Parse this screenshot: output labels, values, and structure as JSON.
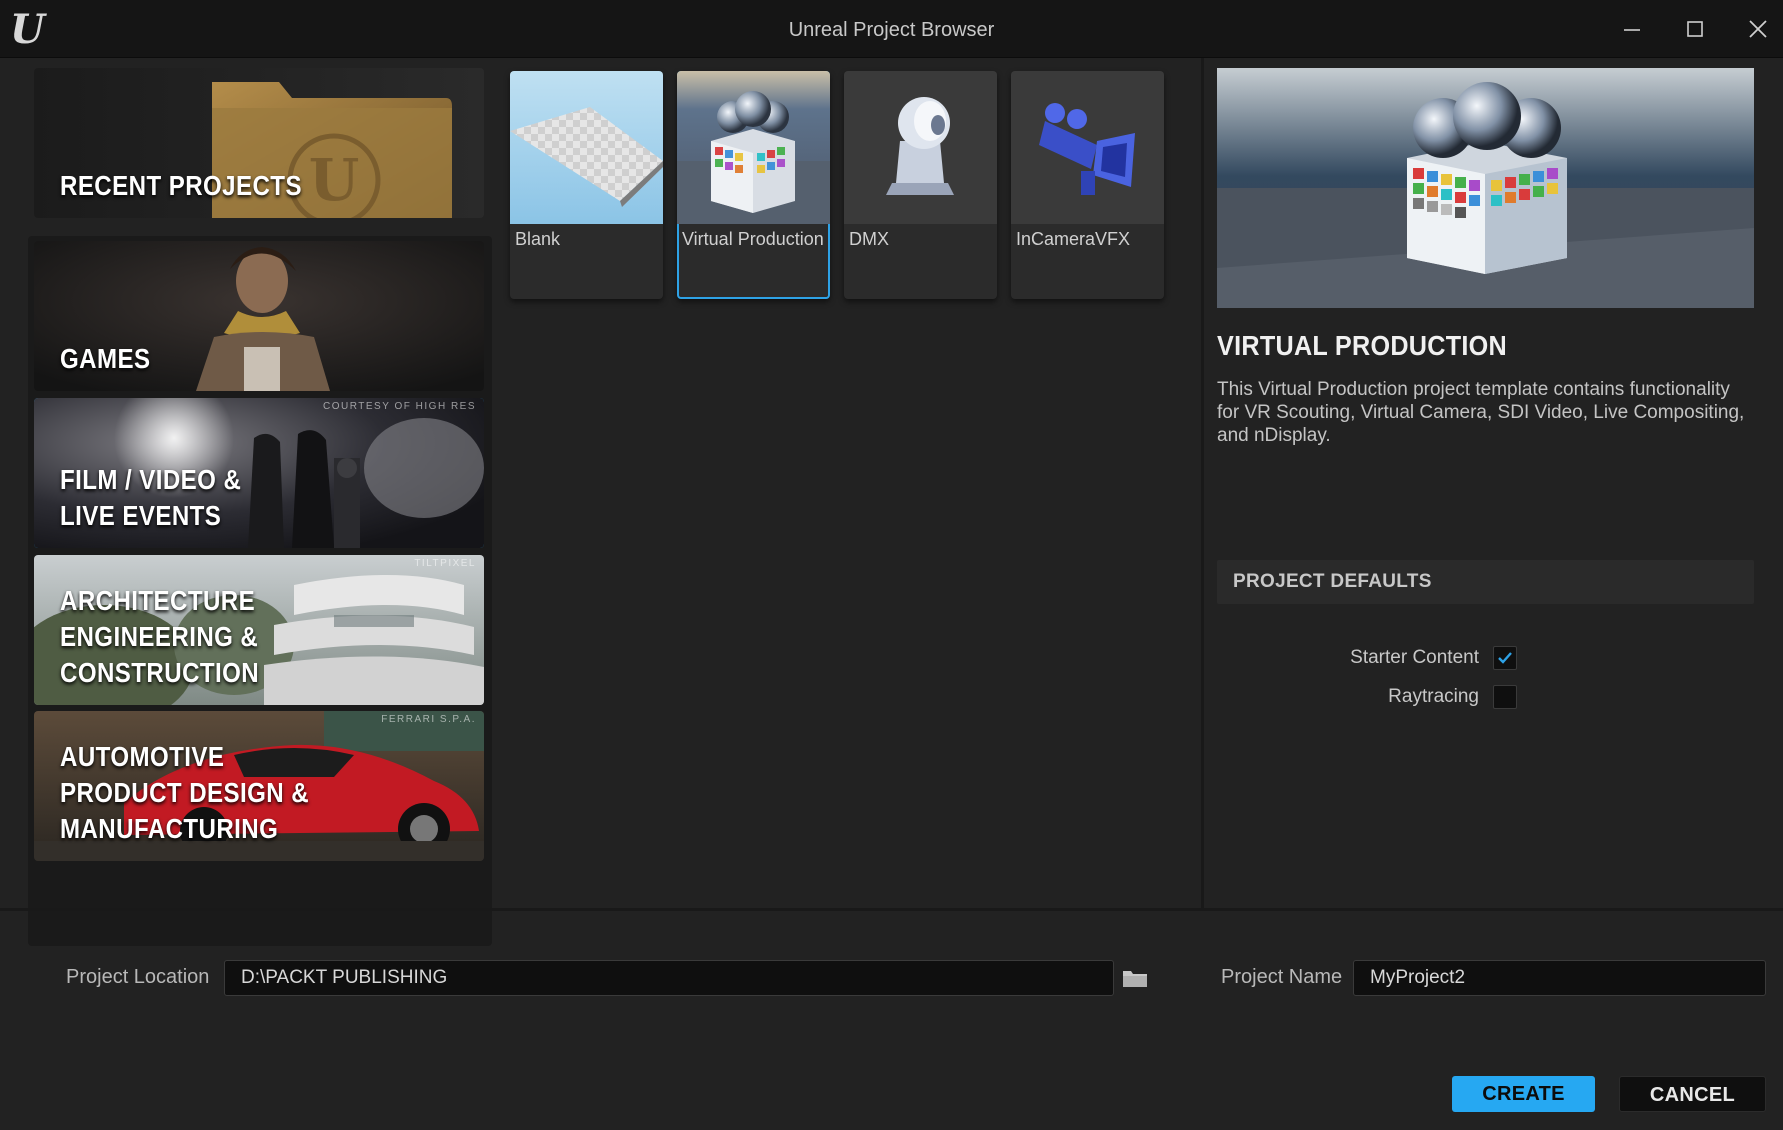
{
  "window": {
    "title": "Unreal Project Browser"
  },
  "categories": [
    {
      "label": "RECENT PROJECTS",
      "credit": ""
    },
    {
      "label": "GAMES",
      "credit": ""
    },
    {
      "label": "FILM / VIDEO &\nLIVE EVENTS",
      "credit": "COURTESY OF HIGH RES"
    },
    {
      "label": "ARCHITECTURE\nENGINEERING &\nCONSTRUCTION",
      "credit": "TILTPIXEL"
    },
    {
      "label": "AUTOMOTIVE\nPRODUCT DESIGN &\nMANUFACTURING",
      "credit": "FERRARI S.P.A."
    }
  ],
  "selected_category": "FILM / VIDEO & LIVE EVENTS",
  "templates": [
    {
      "label": "Blank"
    },
    {
      "label": "Virtual Production"
    },
    {
      "label": "DMX"
    },
    {
      "label": "InCameraVFX"
    }
  ],
  "selected_template": "Virtual Production",
  "details": {
    "title": "VIRTUAL PRODUCTION",
    "description": "This Virtual Production project template contains functionality for VR Scouting, Virtual Camera, SDI Video, Live Compositing, and nDisplay.",
    "defaults_header": "PROJECT DEFAULTS",
    "options": [
      {
        "label": "Starter Content",
        "checked": true
      },
      {
        "label": "Raytracing",
        "checked": false
      }
    ]
  },
  "bottom": {
    "location_label": "Project Location",
    "location_value": "D:\\PACKT PUBLISHING",
    "name_label": "Project Name",
    "name_value": "MyProject2",
    "create_label": "CREATE",
    "cancel_label": "CANCEL"
  },
  "colors": {
    "accent": "#26a8f2",
    "selection_outline": "#2ea2e6",
    "background": "#222222"
  }
}
